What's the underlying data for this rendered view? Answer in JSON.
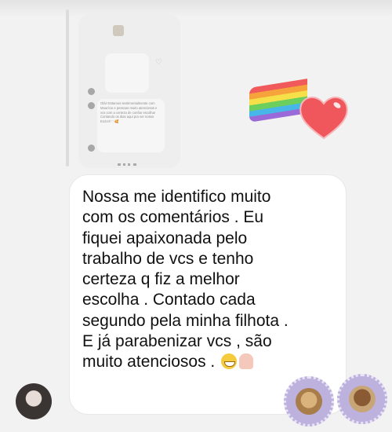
{
  "thread": {
    "preview": {
      "bubble1_text": "",
      "bubble2_text": "Olá!! Estamos sentimentalmente com Maurício e pessoas muito atenciosas e vcs com a certeza de confiar escolha! Contando os dias aqui pra ver nosso Enzo!!! ♡",
      "bubble2_emoji": "🥰"
    }
  },
  "comment": {
    "text": "Nossa me identifico muito\ncom os comentários . Eu\nfiquei apaixonada pelo\ntrabalho de vcs e tenho\ncerteza q fiz a melhor\nescolha . Contado cada\nsegundo pela minha filhota .\nE já parabenizar vcs , são\nmuito atenciosos . ",
    "emoji_1": "grinning-face",
    "emoji_2": "raising-hands"
  },
  "stickers": {
    "decor": [
      "rainbow-sticker",
      "heart-sticker",
      "dog-sticker",
      "dog-sticker"
    ],
    "colors": {
      "heart": "#f0575d",
      "sticker_bg": "#bdb1de"
    }
  }
}
